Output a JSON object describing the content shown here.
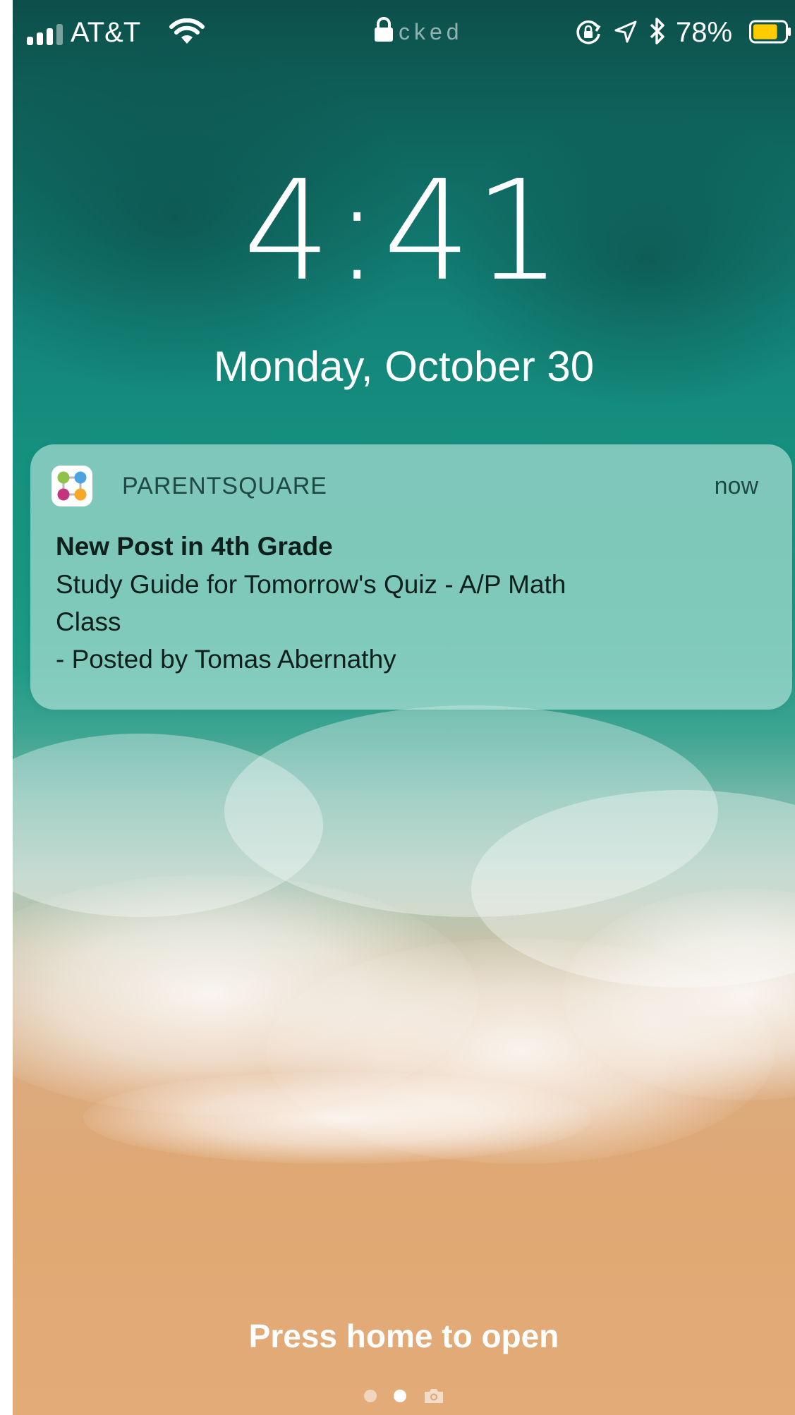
{
  "status_bar": {
    "carrier": "AT&T",
    "lock_text": "cked",
    "battery_percent": "78%",
    "battery_level": 0.78,
    "signal_bars": 4,
    "signal_bars_filled": 3,
    "icons": [
      "wifi-icon",
      "lock-icon",
      "orientation-lock-icon",
      "location-icon",
      "bluetooth-icon",
      "battery-icon"
    ]
  },
  "lock_screen": {
    "time": "4:41",
    "date": "Monday, October 30",
    "footer_hint": "Press home to open"
  },
  "notification": {
    "app_name": "PARENTSQUARE",
    "time": "now",
    "title": "New Post in 4th Grade",
    "body_lines": [
      "Study Guide for Tomorrow's Quiz - A/P Math",
      "Class",
      "- Posted by Tomas Abernathy"
    ],
    "app_icon_colors": [
      "#8fc14b",
      "#4da3e0",
      "#c2377c",
      "#f4a92a"
    ]
  },
  "page_indicator": {
    "pages": 2,
    "active_index": 1,
    "extra": "camera-icon"
  },
  "colors": {
    "battery_fill": "#ffcc00",
    "text": "#ffffff"
  }
}
